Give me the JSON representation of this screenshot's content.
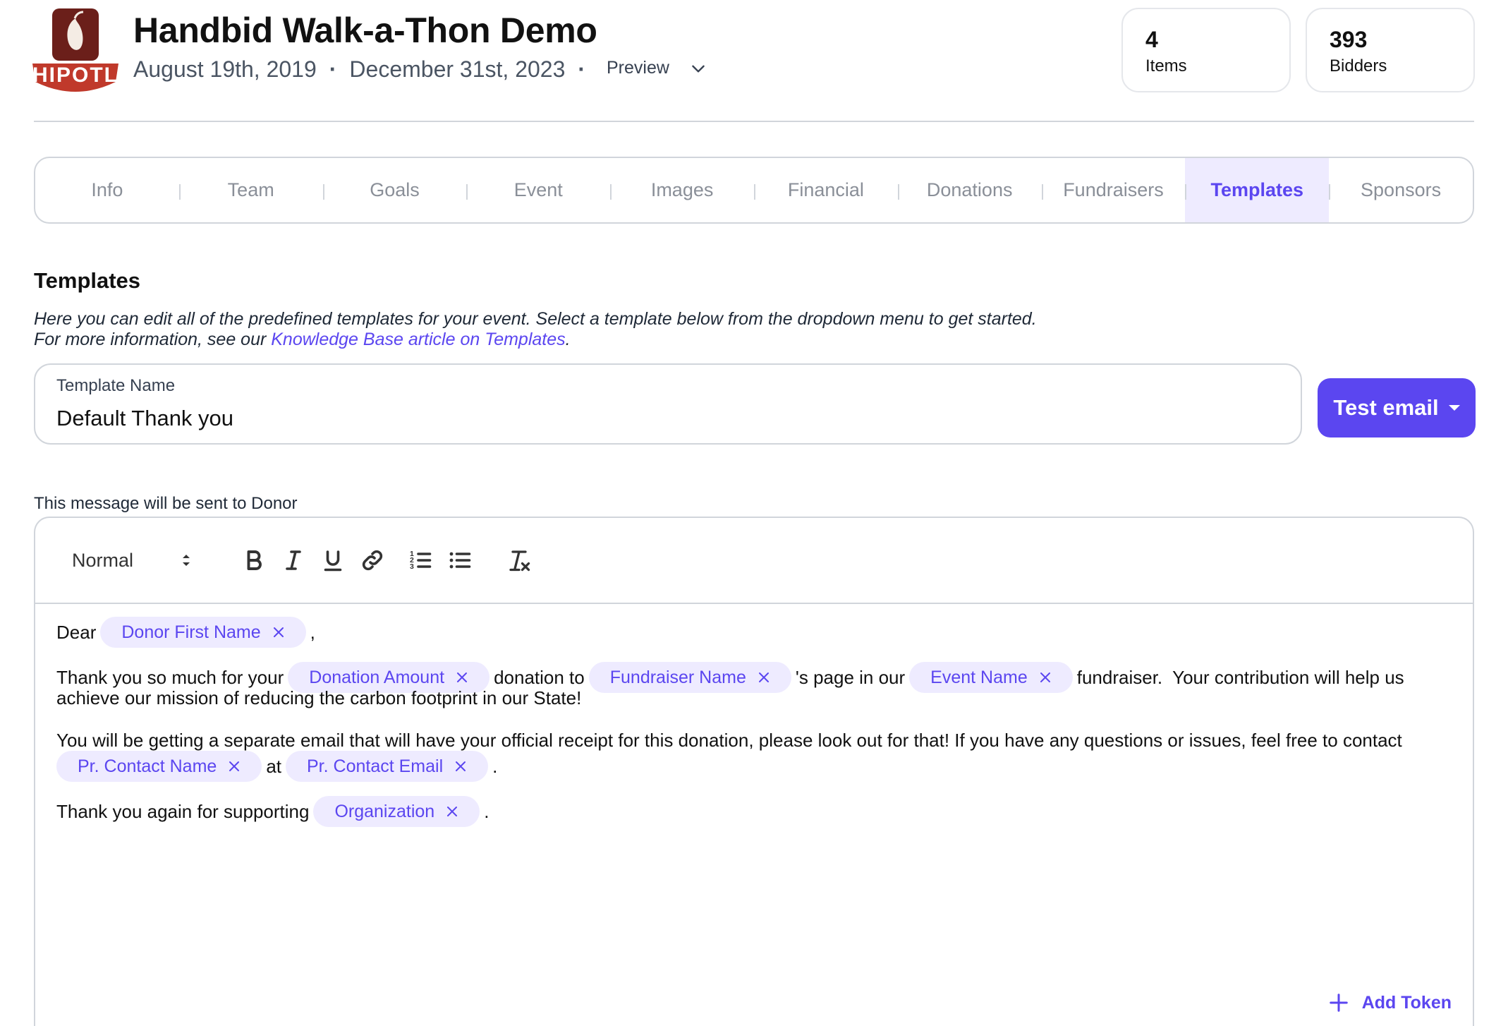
{
  "header": {
    "title": "Handbid Walk-a-Thon Demo",
    "start_date": "August 19th, 2019",
    "end_date": "December 31st, 2023",
    "separator": "·",
    "preview_label": "Preview",
    "logo_text": "HIPOTL",
    "logo_icon": "chili-pepper-logo"
  },
  "stats": [
    {
      "value": "4",
      "label": "Items"
    },
    {
      "value": "393",
      "label": "Bidders"
    }
  ],
  "tabs": [
    "Info",
    "Team",
    "Goals",
    "Event",
    "Images",
    "Financial",
    "Donations",
    "Fundraisers",
    "Templates",
    "Sponsors"
  ],
  "active_tab": "Templates",
  "section": {
    "title": "Templates",
    "description_line1": "Here you can edit all of the predefined templates for your event. Select a template below from the dropdown menu to get started.",
    "description_line2_prefix": "For more information, see our ",
    "link_text": "Knowledge Base article on Templates",
    "description_line2_suffix": "."
  },
  "template_field": {
    "label": "Template Name",
    "value": "Default Thank you"
  },
  "test_email_button": "Test email",
  "recipient_note": "This message will be sent to Donor",
  "toolbar": {
    "format": "Normal",
    "buttons": [
      "bold-icon",
      "italic-icon",
      "underline-icon",
      "link-icon",
      "ordered-list-icon",
      "bullet-list-icon",
      "clear-format-icon"
    ]
  },
  "message": {
    "greeting": "Dear",
    "token_donor_first_name": "Donor First Name",
    "comma": ",",
    "p2_text1": "Thank you so much for your",
    "token_donation_amount": "Donation Amount",
    "p2_text2": "donation to",
    "token_fundraiser_name": "Fundraiser Name",
    "p2_text3": "'s page in our",
    "token_event_name": "Event Name",
    "p2_text4": "fundraiser.  Your contribution will help us",
    "p2_line2": "achieve our mission of reducing the carbon footprint in our State!",
    "p3_line1": "You will be getting a separate email that will have your official receipt for this donation, please look out for that!  If you have any questions or issues, feel free to contact",
    "token_contact_name": "Pr. Contact Name",
    "p3_at": "at",
    "token_contact_email": "Pr. Contact Email",
    "p3_period": ".",
    "p4_text": "Thank you again for supporting",
    "token_organization": "Organization",
    "p4_period": "."
  },
  "add_token_label": "Add Token",
  "colors": {
    "accent": "#5b46f0",
    "token_bg": "#eeebff",
    "border": "#d1d5db",
    "logo_red": "#c0392b",
    "logo_dark": "#6b1f1a"
  }
}
